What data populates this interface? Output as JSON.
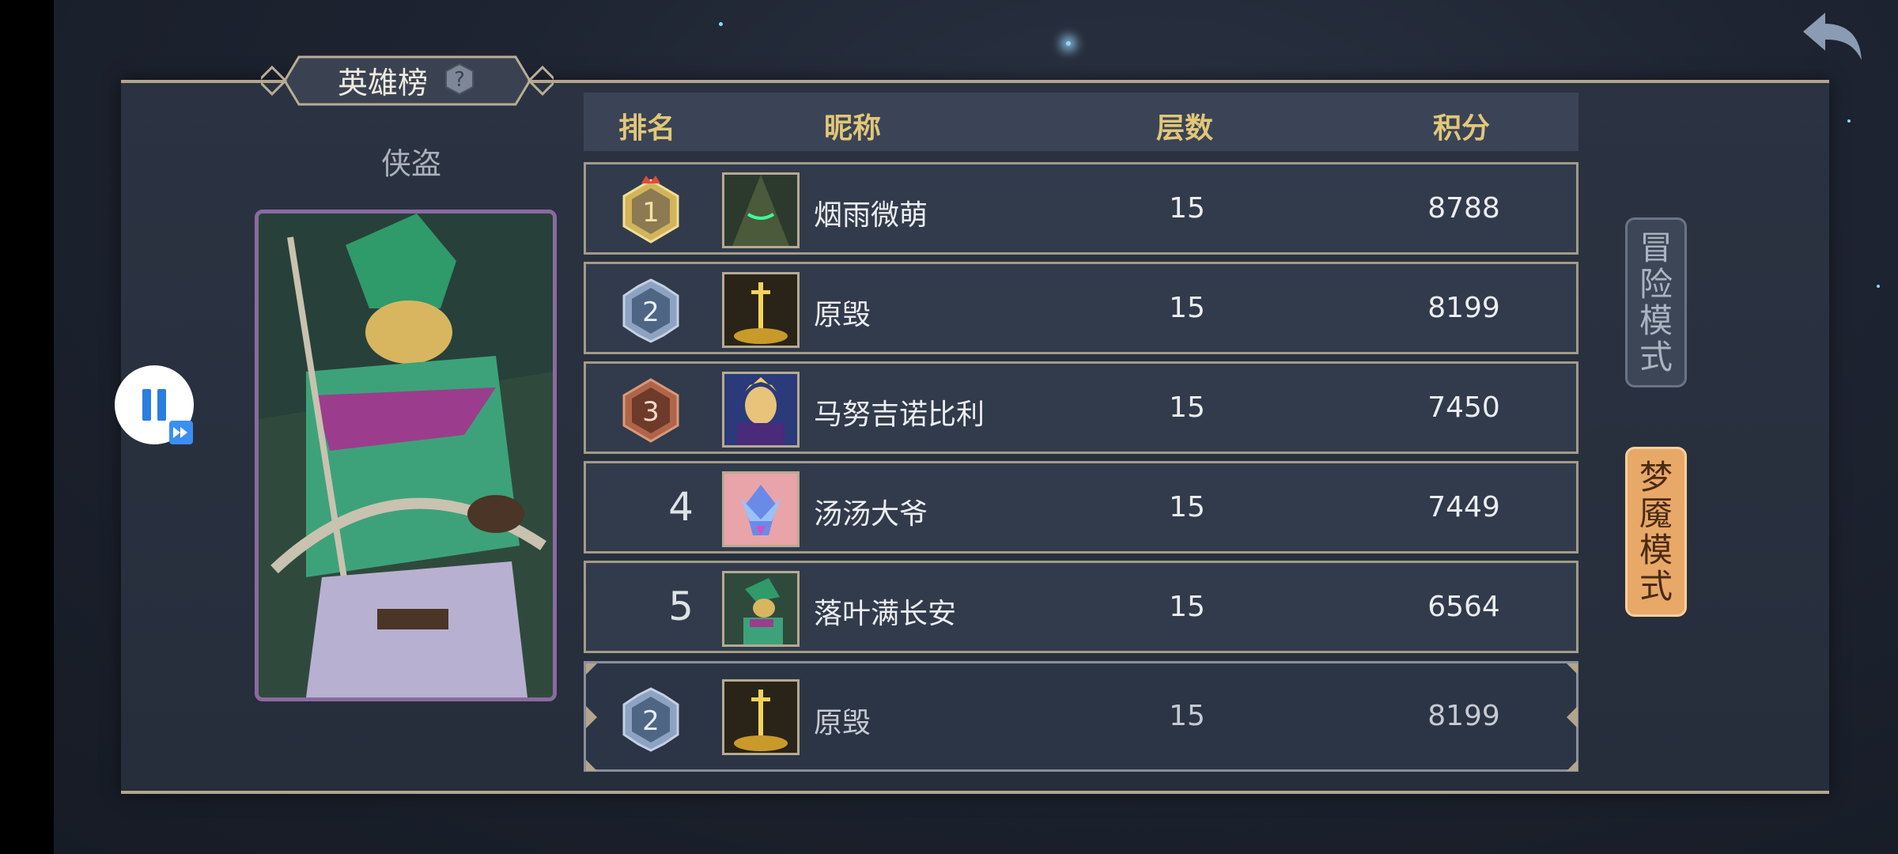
{
  "leaderboard": {
    "title": "英雄榜",
    "hero_class": "侠盗",
    "columns": {
      "rank": "排名",
      "nickname": "昵称",
      "floor": "层数",
      "score": "积分"
    },
    "rows": [
      {
        "rank": "1",
        "nickname": "烟雨微萌",
        "floor": "15",
        "score": "8788",
        "medal": "gold"
      },
      {
        "rank": "2",
        "nickname": "原毁",
        "floor": "15",
        "score": "8199",
        "medal": "silver"
      },
      {
        "rank": "3",
        "nickname": "马努吉诺比利",
        "floor": "15",
        "score": "7450",
        "medal": "bronze"
      },
      {
        "rank": "4",
        "nickname": "汤汤大爷",
        "floor": "15",
        "score": "7449",
        "medal": "none"
      },
      {
        "rank": "5",
        "nickname": "落叶满长安",
        "floor": "15",
        "score": "6564",
        "medal": "none"
      }
    ],
    "my_entry": {
      "rank": "2",
      "nickname": "原毁",
      "floor": "15",
      "score": "8199",
      "medal": "silver"
    }
  },
  "modes": {
    "adventure": [
      "冒",
      "险",
      "模",
      "式"
    ],
    "nightmare": [
      "梦",
      "魇",
      "模",
      "式"
    ]
  },
  "colors": {
    "header_text": "#e2c777",
    "gold_medal": "#d2b45a",
    "silver_medal": "#8ea3c2",
    "bronze_medal": "#b0654a",
    "active_mode": "#e8a868"
  },
  "icons": [
    "back-arrow-icon",
    "help-question-icon",
    "pause-icon",
    "fast-forward-icon"
  ]
}
